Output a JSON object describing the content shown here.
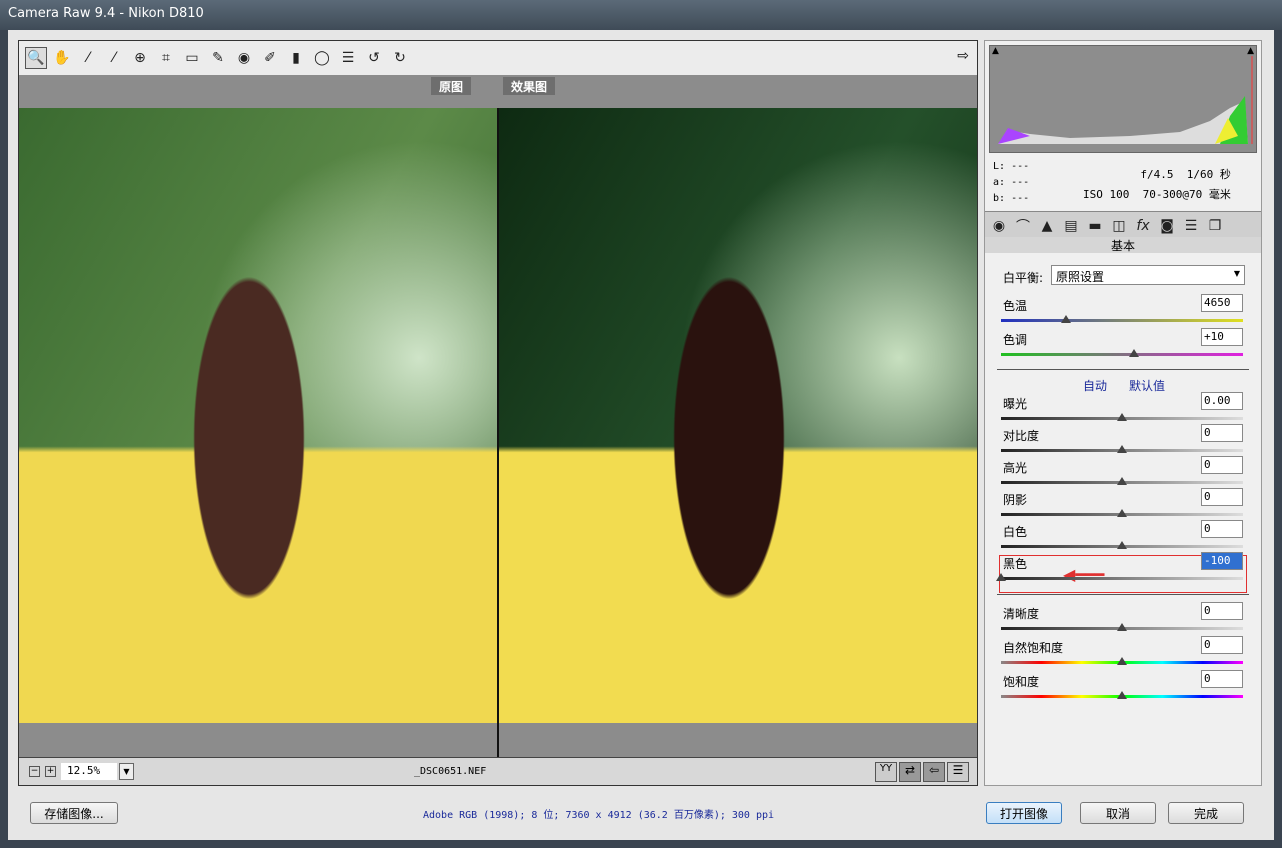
{
  "window": {
    "title": "Camera Raw 9.4 -  Nikon D810"
  },
  "toolbar": {
    "tools": [
      {
        "icon": "zoom-icon",
        "glyph": "🔍"
      },
      {
        "icon": "hand-icon",
        "glyph": "✋"
      },
      {
        "icon": "white-balance-icon",
        "glyph": "⁄"
      },
      {
        "icon": "color-sampler-icon",
        "glyph": "⁄"
      },
      {
        "icon": "targeted-adjust-icon",
        "glyph": "⊕"
      },
      {
        "icon": "crop-icon",
        "glyph": "⌗"
      },
      {
        "icon": "straighten-icon",
        "glyph": "▭"
      },
      {
        "icon": "spot-removal-icon",
        "glyph": "✎"
      },
      {
        "icon": "red-eye-icon",
        "glyph": "◉"
      },
      {
        "icon": "adjustment-brush-icon",
        "glyph": "✐"
      },
      {
        "icon": "graduated-filter-icon",
        "glyph": "▮"
      },
      {
        "icon": "radial-filter-icon",
        "glyph": "◯"
      },
      {
        "icon": "preferences-icon",
        "glyph": "☰"
      },
      {
        "icon": "rotate-left-icon",
        "glyph": "↺"
      },
      {
        "icon": "rotate-right-icon",
        "glyph": "↻"
      }
    ],
    "export_icon": "export-icon"
  },
  "preview": {
    "before_label": "原图",
    "after_label": "效果图",
    "zoom": "12.5%",
    "filename": "_DSC0651.NEF"
  },
  "info": {
    "L": "L:",
    "a": "a:",
    "b": "b:",
    "dash": "---",
    "aperture": "f/4.5",
    "shutter": "1/60 秒",
    "iso": "ISO 100",
    "lens": "70-300@70 毫米"
  },
  "panel": {
    "title": "基本",
    "wb_label": "白平衡:",
    "wb_value": "原照设置",
    "auto": "自动",
    "default": "默认值",
    "sliders": [
      {
        "label": "色温",
        "value": "4650",
        "pos": 0.27,
        "track": "temp"
      },
      {
        "label": "色调",
        "value": "+10",
        "pos": 0.55,
        "track": "tint"
      },
      {
        "label": "曝光",
        "value": "0.00",
        "pos": 0.5,
        "track": "gray"
      },
      {
        "label": "对比度",
        "value": "0",
        "pos": 0.5,
        "track": "gray"
      },
      {
        "label": "高光",
        "value": "0",
        "pos": 0.5,
        "track": "gray"
      },
      {
        "label": "阴影",
        "value": "0",
        "pos": 0.5,
        "track": "gray"
      },
      {
        "label": "白色",
        "value": "0",
        "pos": 0.5,
        "track": "gray"
      },
      {
        "label": "黑色",
        "value": "-100",
        "pos": 0.0,
        "track": "gray"
      },
      {
        "label": "清晰度",
        "value": "0",
        "pos": 0.5,
        "track": "gray"
      },
      {
        "label": "自然饱和度",
        "value": "0",
        "pos": 0.5,
        "track": "rainbow"
      },
      {
        "label": "饱和度",
        "value": "0",
        "pos": 0.5,
        "track": "rainbow"
      }
    ]
  },
  "footer": {
    "save": "存储图像...",
    "info_link": "Adobe RGB (1998); 8 位; 7360 x 4912 (36.2 百万像素); 300 ppi",
    "open": "打开图像",
    "cancel": "取消",
    "done": "完成"
  },
  "colors": {
    "highlight": "#e03030"
  }
}
